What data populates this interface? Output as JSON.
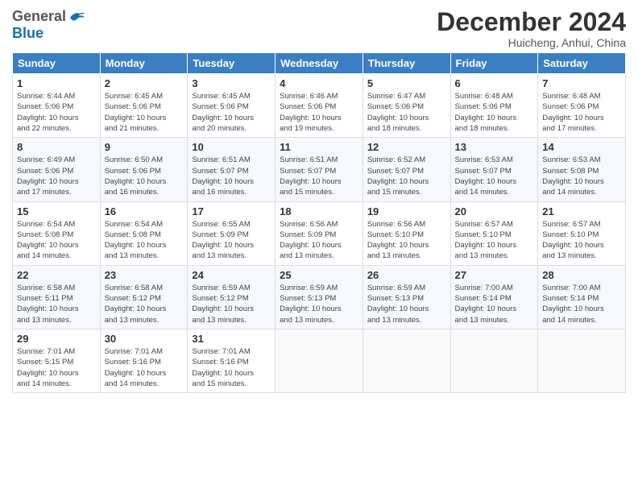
{
  "header": {
    "logo_general": "General",
    "logo_blue": "Blue",
    "month_title": "December 2024",
    "location": "Huicheng, Anhui, China"
  },
  "weekdays": [
    "Sunday",
    "Monday",
    "Tuesday",
    "Wednesday",
    "Thursday",
    "Friday",
    "Saturday"
  ],
  "weeks": [
    [
      {
        "day": "1",
        "info": "Sunrise: 6:44 AM\nSunset: 5:06 PM\nDaylight: 10 hours\nand 22 minutes."
      },
      {
        "day": "2",
        "info": "Sunrise: 6:45 AM\nSunset: 5:06 PM\nDaylight: 10 hours\nand 21 minutes."
      },
      {
        "day": "3",
        "info": "Sunrise: 6:45 AM\nSunset: 5:06 PM\nDaylight: 10 hours\nand 20 minutes."
      },
      {
        "day": "4",
        "info": "Sunrise: 6:46 AM\nSunset: 5:06 PM\nDaylight: 10 hours\nand 19 minutes."
      },
      {
        "day": "5",
        "info": "Sunrise: 6:47 AM\nSunset: 5:06 PM\nDaylight: 10 hours\nand 18 minutes."
      },
      {
        "day": "6",
        "info": "Sunrise: 6:48 AM\nSunset: 5:06 PM\nDaylight: 10 hours\nand 18 minutes."
      },
      {
        "day": "7",
        "info": "Sunrise: 6:48 AM\nSunset: 5:06 PM\nDaylight: 10 hours\nand 17 minutes."
      }
    ],
    [
      {
        "day": "8",
        "info": "Sunrise: 6:49 AM\nSunset: 5:06 PM\nDaylight: 10 hours\nand 17 minutes."
      },
      {
        "day": "9",
        "info": "Sunrise: 6:50 AM\nSunset: 5:06 PM\nDaylight: 10 hours\nand 16 minutes."
      },
      {
        "day": "10",
        "info": "Sunrise: 6:51 AM\nSunset: 5:07 PM\nDaylight: 10 hours\nand 16 minutes."
      },
      {
        "day": "11",
        "info": "Sunrise: 6:51 AM\nSunset: 5:07 PM\nDaylight: 10 hours\nand 15 minutes."
      },
      {
        "day": "12",
        "info": "Sunrise: 6:52 AM\nSunset: 5:07 PM\nDaylight: 10 hours\nand 15 minutes."
      },
      {
        "day": "13",
        "info": "Sunrise: 6:53 AM\nSunset: 5:07 PM\nDaylight: 10 hours\nand 14 minutes."
      },
      {
        "day": "14",
        "info": "Sunrise: 6:53 AM\nSunset: 5:08 PM\nDaylight: 10 hours\nand 14 minutes."
      }
    ],
    [
      {
        "day": "15",
        "info": "Sunrise: 6:54 AM\nSunset: 5:08 PM\nDaylight: 10 hours\nand 14 minutes."
      },
      {
        "day": "16",
        "info": "Sunrise: 6:54 AM\nSunset: 5:08 PM\nDaylight: 10 hours\nand 13 minutes."
      },
      {
        "day": "17",
        "info": "Sunrise: 6:55 AM\nSunset: 5:09 PM\nDaylight: 10 hours\nand 13 minutes."
      },
      {
        "day": "18",
        "info": "Sunrise: 6:56 AM\nSunset: 5:09 PM\nDaylight: 10 hours\nand 13 minutes."
      },
      {
        "day": "19",
        "info": "Sunrise: 6:56 AM\nSunset: 5:10 PM\nDaylight: 10 hours\nand 13 minutes."
      },
      {
        "day": "20",
        "info": "Sunrise: 6:57 AM\nSunset: 5:10 PM\nDaylight: 10 hours\nand 13 minutes."
      },
      {
        "day": "21",
        "info": "Sunrise: 6:57 AM\nSunset: 5:10 PM\nDaylight: 10 hours\nand 13 minutes."
      }
    ],
    [
      {
        "day": "22",
        "info": "Sunrise: 6:58 AM\nSunset: 5:11 PM\nDaylight: 10 hours\nand 13 minutes."
      },
      {
        "day": "23",
        "info": "Sunrise: 6:58 AM\nSunset: 5:12 PM\nDaylight: 10 hours\nand 13 minutes."
      },
      {
        "day": "24",
        "info": "Sunrise: 6:59 AM\nSunset: 5:12 PM\nDaylight: 10 hours\nand 13 minutes."
      },
      {
        "day": "25",
        "info": "Sunrise: 6:59 AM\nSunset: 5:13 PM\nDaylight: 10 hours\nand 13 minutes."
      },
      {
        "day": "26",
        "info": "Sunrise: 6:59 AM\nSunset: 5:13 PM\nDaylight: 10 hours\nand 13 minutes."
      },
      {
        "day": "27",
        "info": "Sunrise: 7:00 AM\nSunset: 5:14 PM\nDaylight: 10 hours\nand 13 minutes."
      },
      {
        "day": "28",
        "info": "Sunrise: 7:00 AM\nSunset: 5:14 PM\nDaylight: 10 hours\nand 14 minutes."
      }
    ],
    [
      {
        "day": "29",
        "info": "Sunrise: 7:01 AM\nSunset: 5:15 PM\nDaylight: 10 hours\nand 14 minutes."
      },
      {
        "day": "30",
        "info": "Sunrise: 7:01 AM\nSunset: 5:16 PM\nDaylight: 10 hours\nand 14 minutes."
      },
      {
        "day": "31",
        "info": "Sunrise: 7:01 AM\nSunset: 5:16 PM\nDaylight: 10 hours\nand 15 minutes."
      },
      {
        "day": "",
        "info": ""
      },
      {
        "day": "",
        "info": ""
      },
      {
        "day": "",
        "info": ""
      },
      {
        "day": "",
        "info": ""
      }
    ]
  ]
}
